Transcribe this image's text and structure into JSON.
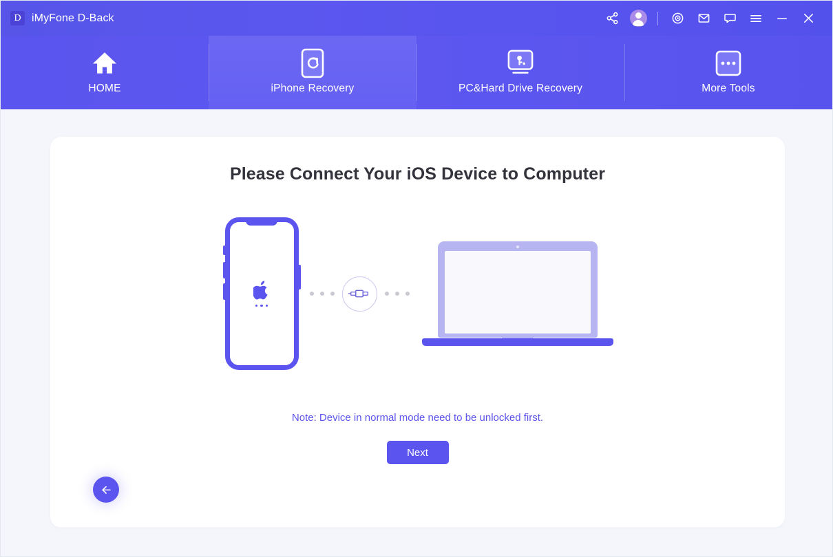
{
  "window": {
    "logo_letter": "D",
    "title": "iMyFone D-Back",
    "actions": [
      {
        "name": "share-icon",
        "label": "Share"
      },
      {
        "name": "account-icon",
        "label": "Account"
      },
      {
        "name": "divider",
        "label": ""
      },
      {
        "name": "settings-icon",
        "label": "Settings"
      },
      {
        "name": "mail-icon",
        "label": "Mail"
      },
      {
        "name": "chat-icon",
        "label": "Feedback"
      },
      {
        "name": "menu-icon",
        "label": "Menu"
      },
      {
        "name": "minimize-icon",
        "label": "Minimize"
      },
      {
        "name": "close-icon",
        "label": "Close"
      }
    ]
  },
  "nav": {
    "tabs": [
      {
        "label": "HOME",
        "icon": "home-icon",
        "active": false
      },
      {
        "label": "iPhone Recovery",
        "icon": "phone-refresh-icon",
        "active": true
      },
      {
        "label": "PC&Hard Drive Recovery",
        "icon": "monitor-key-icon",
        "active": false
      },
      {
        "label": "More Tools",
        "icon": "more-dots-icon",
        "active": false
      }
    ]
  },
  "main": {
    "title": "Please Connect Your iOS Device to Computer",
    "note": "Note: Device in normal mode need to be unlocked first.",
    "next_label": "Next",
    "back_label": "Back",
    "illustration": {
      "device_left": "iphone",
      "device_right": "laptop",
      "connector": "usb-cable-icon",
      "phone_screen_glyph": "apple-logo"
    }
  },
  "colors": {
    "brand_purple": "#5b54ee",
    "titlebar": "#5655e8",
    "nav_active": "#6c67f3",
    "page_background": "#f4f6fb",
    "card": "#ffffff",
    "title_text": "#33333c",
    "note_text": "#5b54ee",
    "laptop_lid": "#b6b5f2",
    "dot_gray": "#c9cad2"
  }
}
